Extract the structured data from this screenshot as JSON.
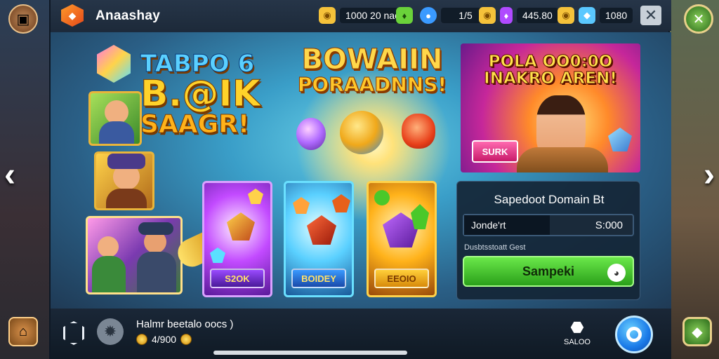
{
  "header": {
    "app_title": "Anaashay",
    "resources": [
      {
        "icon": "gold-coin-icon",
        "value": "1000 20 nao",
        "color": "#f5c23a"
      },
      {
        "icon": "green-gem-icon",
        "value": "",
        "color": "#6ad23a"
      },
      {
        "icon": "blue-orb-icon",
        "value": "1/5",
        "color": "#3a9aff"
      },
      {
        "icon": "gold-coin-icon",
        "value": "",
        "color": "#f5c23a"
      },
      {
        "icon": "purple-gem-icon",
        "value": "445.80",
        "color": "#b04aff"
      },
      {
        "icon": "gold-coin-icon",
        "value": "",
        "color": "#f5c23a"
      },
      {
        "icon": "blue-crystal-icon",
        "value": "1080",
        "color": "#5ac8ff"
      }
    ],
    "close_label": "✕"
  },
  "stage": {
    "title_logo": {
      "line1": "TABPO 6",
      "line2": "B.@IK",
      "line3": "SAAGR!"
    },
    "headline": {
      "line1": "BOWAIIN",
      "line2": "PORAADNNS!"
    },
    "promo": {
      "title_line1": "POLA OO0:0O",
      "title_line2": "INAKRO AREN!",
      "button": "SURK"
    },
    "loot_cards": [
      {
        "button": "S2OK",
        "color": "#9a4aff"
      },
      {
        "button": "BOIDEY",
        "color": "#3a9aff"
      },
      {
        "button": "EEOIO",
        "color": "#ffcf3a"
      }
    ],
    "donate": {
      "title": "Sapedoot Domain Bt",
      "field_label": "Jonde'rt",
      "field_value": "S:000",
      "hint": "Dusbtsstoatt Gest",
      "button": "Sampeki",
      "button_icon": "smile-icon"
    }
  },
  "bottom": {
    "player_label": "Halmr beetalo oocs )",
    "coins": "4/900",
    "map_label": "SALOO"
  }
}
